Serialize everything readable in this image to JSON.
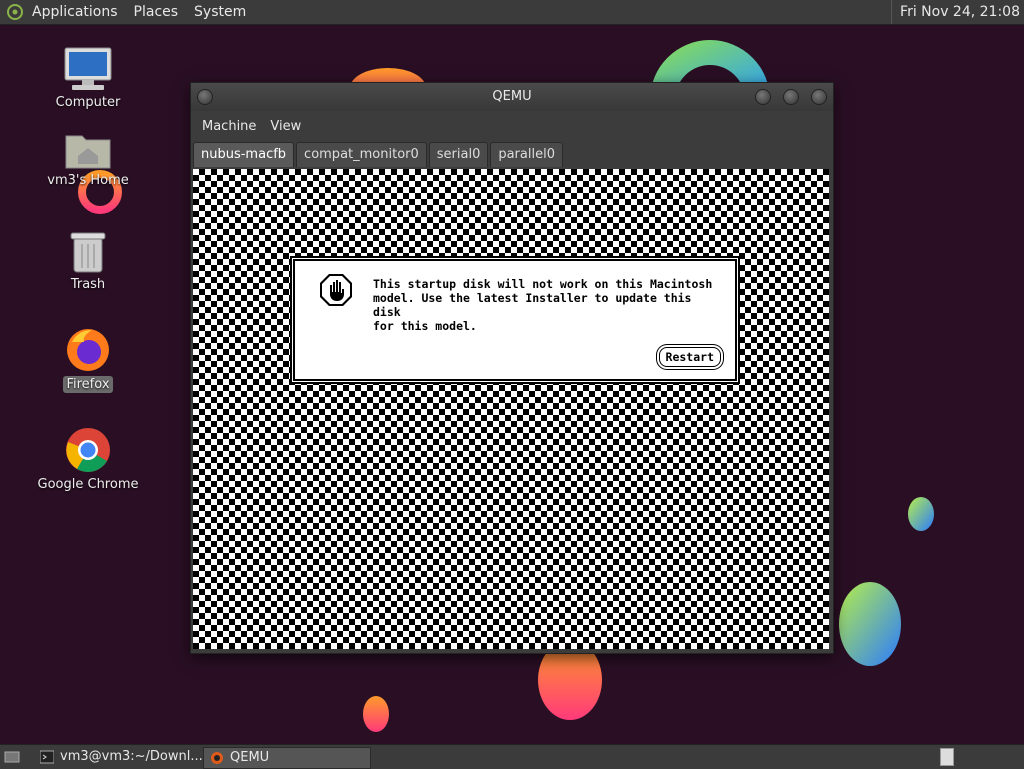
{
  "top_panel": {
    "menus": [
      "Applications",
      "Places",
      "System"
    ],
    "clock": "Fri Nov 24, 21:08"
  },
  "desktop": {
    "icons": [
      {
        "label": "Computer",
        "icon": "computer-icon"
      },
      {
        "label": "vm3's Home",
        "icon": "home-folder-icon"
      },
      {
        "label": "Trash",
        "icon": "trash-icon"
      },
      {
        "label": "Firefox",
        "icon": "firefox-icon"
      },
      {
        "label": "Google Chrome",
        "icon": "chrome-icon"
      }
    ]
  },
  "qemu": {
    "title": "QEMU",
    "menu": [
      "Machine",
      "View"
    ],
    "tabs": [
      "nubus-macfb",
      "compat_monitor0",
      "serial0",
      "parallel0"
    ],
    "alert": {
      "line1": "This startup disk will not work on this Macintosh",
      "line2": "model.  Use the latest Installer to update this disk",
      "line3": "for this model.",
      "button": "Restart"
    }
  },
  "taskbar": {
    "items": [
      {
        "label": "vm3@vm3:~/Downl...",
        "icon": "terminal-icon"
      },
      {
        "label": "QEMU",
        "icon": "qemu-icon"
      }
    ]
  },
  "colors": {
    "wallpaper": "#2a0f24",
    "panel": "#3b3b3b"
  }
}
